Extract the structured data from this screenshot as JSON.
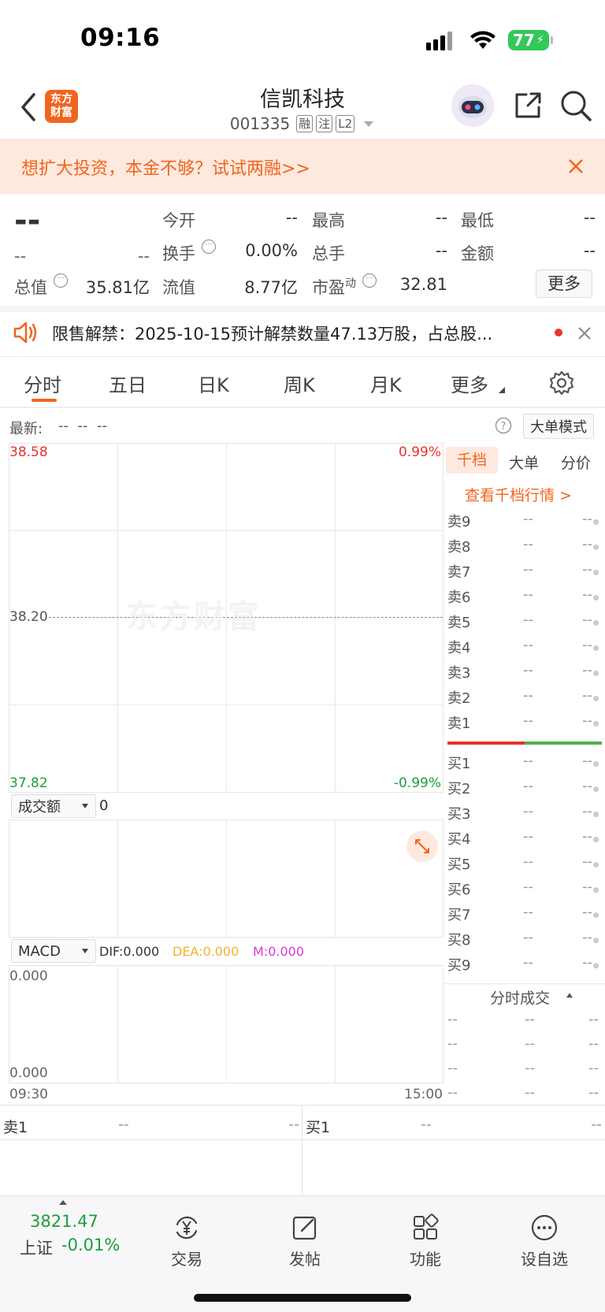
{
  "status_bar": {
    "time": "09:16",
    "battery": "77"
  },
  "header": {
    "logo_text": "东方\n财富",
    "stock_name": "信凯科技",
    "stock_code": "001335",
    "tags": [
      "融",
      "注",
      "L2"
    ]
  },
  "banner": {
    "text": "想扩大投资，本金不够？试试两融>>"
  },
  "quote": {
    "price": "--",
    "change": "--",
    "change_pct": "--",
    "open_label": "今开",
    "open": "--",
    "high_label": "最高",
    "high": "--",
    "low_label": "最低",
    "low": "--",
    "turnover_label": "换手",
    "turnover": "0.00%",
    "volume_label": "总手",
    "volume": "--",
    "amount_label": "金额",
    "amount": "--",
    "mktcap_label": "总值",
    "mktcap": "35.81亿",
    "float_label": "流值",
    "float": "8.77亿",
    "pe_label": "市盈",
    "pe_sup": "动",
    "pe": "32.81",
    "more_button": "更多"
  },
  "notice": {
    "text": "限售解禁：2025-10-15预计解禁数量47.13万股，占总股..."
  },
  "tabs": [
    "分时",
    "五日",
    "日K",
    "周K",
    "月K",
    "更多"
  ],
  "chart": {
    "latest_label": "最新:",
    "latest_vals": "--  --  --",
    "big_order_button": "大单模式",
    "price_high": "38.58",
    "pct_high": "0.99%",
    "price_mid": "38.20",
    "price_low": "37.82",
    "pct_low": "-0.99%",
    "watermark": "东方财富",
    "volume_selector": "成交额",
    "volume_value": "0",
    "macd_selector": "MACD",
    "dif": "DIF:0.000",
    "dea": "DEA:0.000",
    "m": "M:0.000",
    "macd_top": "0.000",
    "macd_bottom": "0.000",
    "time_start": "09:30",
    "time_end": "15:00"
  },
  "orderbook": {
    "tabs": [
      "千档",
      "大单",
      "分价"
    ],
    "link": "查看千档行情 >",
    "sell": [
      "卖9",
      "卖8",
      "卖7",
      "卖6",
      "卖5",
      "卖4",
      "卖3",
      "卖2",
      "卖1"
    ],
    "buy": [
      "买1",
      "买2",
      "买3",
      "买4",
      "买5",
      "买6",
      "买7",
      "买8",
      "买9"
    ],
    "placeholder": "--",
    "trades_title": "分时成交"
  },
  "bottom_quote": {
    "sell1_label": "卖1",
    "sell1_a": "--",
    "sell1_b": "--",
    "buy1_label": "买1",
    "buy1_a": "--",
    "buy1_b": "--"
  },
  "bottom_nav": {
    "index_value": "3821.47",
    "index_name": "上证",
    "index_change": "-0.01%",
    "items": [
      "交易",
      "发帖",
      "功能",
      "设自选"
    ]
  }
}
